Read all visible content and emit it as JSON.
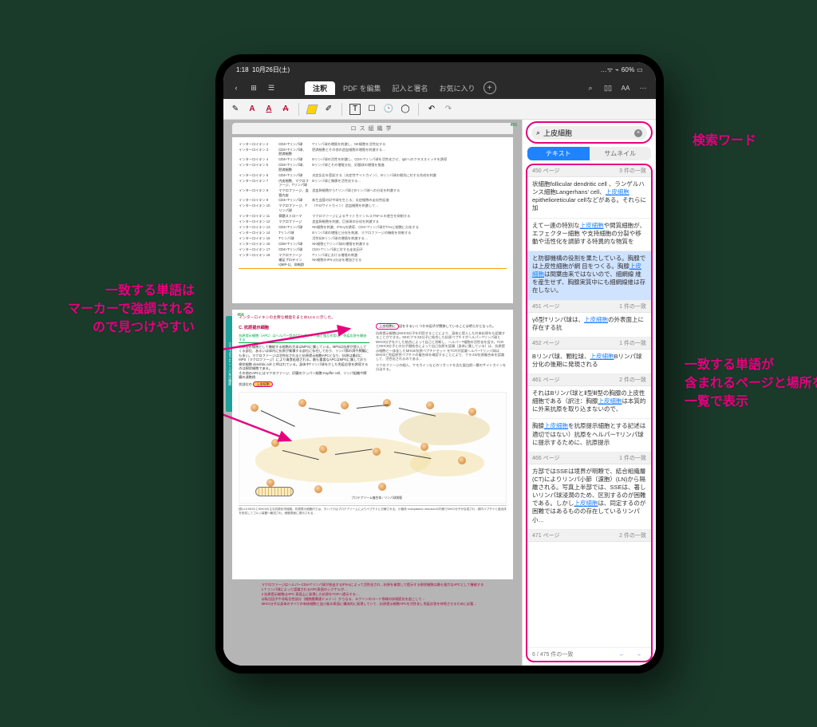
{
  "status": {
    "time": "1:18",
    "date": "10月26日(土)",
    "battery": "60%",
    "indicators": "…ᯤ ⌁"
  },
  "toolbar": {
    "tabs": {
      "active": "注釈",
      "edit": "PDF を編集",
      "sign": "記入と署名",
      "favorites": "お気に入り"
    }
  },
  "doc": {
    "tab_title": "ロス組織学",
    "page_a": "454",
    "page_b": "455",
    "section_title_c": "C. 抗原提示細胞",
    "section_sub_c": "抗原提示細胞（APC）はヘルパー型のCD4+Tリンパ球と相互作用し、免疫応答を開始する",
    "sidebar_label": "CHAPTER 14  リンパ系の機能",
    "highlight_term": "上皮細胞",
    "interleukins": [
      {
        "c1": "インターロイキン 2",
        "c2": "CD4+Tリンパ球",
        "c3": "Tリンパ球の増殖を刺激し、NK細胞を活性化する"
      },
      {
        "c1": "インターロイキン 3",
        "c2": "CD4+Tリンパ球、肥満細胞",
        "c3": "肥満細胞とその他の造血細胞の増殖を刺激する…"
      },
      {
        "c1": "インターロイキン 4",
        "c2": "CD4+Tリンパ球",
        "c3": "Bリンパ球の活性を刺激し、CD4+Tリンパ球を活性化させ、IgEへのクラススイッチを誘導"
      },
      {
        "c1": "インターロイキン 5",
        "c2": "CD4+Tリンパ球、肥満細胞",
        "c3": "Bリンパ球とその増殖分化、好酸球の増殖を推進"
      },
      {
        "c1": "インターロイキン 6",
        "c2": "CD4+Tリンパ球",
        "c3": "炎症反応を惹起する（炎症性サイトカイン）、Bリンパ球の場合に対する合成を刺激"
      },
      {
        "c1": "インターロイキン 7",
        "c2": "内皮細胞、マクロファージ、Tリンパ球",
        "c3": "Bリンパ球と胸腺を活性化する…"
      },
      {
        "c1": "インターロイキン 8",
        "c2": "マクロファージ、血管内皮",
        "c3": "造血幹細胞からTリンパ球とBリンパ球への分化を刺激する"
      },
      {
        "c1": "インターロイキン 9",
        "c2": "CD4+Tリンパ球",
        "c3": "新生血管の好中球を生じる；炎症細胞の走化性促進"
      },
      {
        "c1": "インターロイキン 10",
        "c2": "マクロファージ、Tリンパ球",
        "c3": "（TH2サイトカイン）造血細胞を刺激して…"
      },
      {
        "c1": "インターロイキン 11",
        "c2": "骨髄ストローマ",
        "c3": "マクロファージによるサイトカイン IL-2,TNF-α の産生を抑制する"
      },
      {
        "c1": "インターロイキン 12",
        "c2": "マクロファージ",
        "c3": "造血幹細胞を刺激、巨核球の分化を刺激する"
      },
      {
        "c1": "インターロイキン 13",
        "c2": "CD4+Tリンパ球",
        "c3": "NK細胞を刺激、IFN-γの誘導、CD4+Tリンパ球がTH1に細胞に分化する"
      },
      {
        "c1": "インターロイキン 14",
        "c2": "Tリンパ球",
        "c3": "Bリンパ球の増殖と分化を刺激、マクロファージの機能を抑制する"
      },
      {
        "c1": "インターロイキン 15",
        "c2": "Tリンパ球",
        "c3": "活性化Bリンパ球の増殖を刺激する…"
      },
      {
        "c1": "インターロイキン 16",
        "c2": "CD8+Tリンパ球",
        "c3": "NK細胞とTリンパ球の増殖を刺激する"
      },
      {
        "c1": "インターロイキン 17",
        "c2": "CD4+Tリンパ球",
        "c3": "CD4+Tリンパ球に対する走化因子"
      },
      {
        "c1": "インターロイキン 18",
        "c2": "マクロファージ",
        "c3": "Tリンパ球における増殖の刺激"
      },
      {
        "c1": "",
        "c2": "補足プロテインⅠ(MIP-1)、抑制群",
        "c3": "NK細胞のIFN-γ分泌を増加させる"
      }
    ]
  },
  "search": {
    "term": "上皮細胞",
    "tab_text": "テキスト",
    "tab_thumb": "サムネイル",
    "results": [
      {
        "page": "450 ページ",
        "count": "3 件の一致",
        "body": "状細胞follicular dendritic cell 、ランゲルハンス細胞Langerhans' cell、{kw}epithelioreticular cellなどがある。それらに加"
      },
      {
        "page": "",
        "count": "",
        "body": "えて一連の特別な{kw}や間質細胞が、エフェクター細胞 や支持細胞の分裂や移動や活性化を調節する特異的な物質を"
      },
      {
        "page": "",
        "count": "",
        "body": "と防御機構の役割を果たしている。胸腺では上皮性細胞が網 目をつくる。胸腺{kw}は間葉由来ではないので、細網線 維を産生せず、胸腺実質中にも細網線維は存在しない。",
        "active": true
      },
      {
        "page": "451 ページ",
        "count": "1 件の一致",
        "body": "γδ型Tリンパ球は、{kw}の外表面上に存在する抗"
      },
      {
        "page": "452 ページ",
        "count": "1 件の一致",
        "body": "Bリンパ球、顆粒球、{kw}Bリンパ球分化の後期に発現される"
      },
      {
        "page": "461 ページ",
        "count": "2 件の一致",
        "body": "それはBリンパ球とⅡ型Ⅲ型の胸腺の上皮性細胞である（訳注：胸腺{kw}は本質的に外来抗原を取り込まないので、"
      },
      {
        "page": "",
        "count": "",
        "body": "胸腺{kw}を抗原提示細胞とする記述は適切ではない）抗原をヘルパーTリンパ球に提示するために、抗原提示"
      },
      {
        "page": "466 ページ",
        "count": "1 件の一致",
        "body": "方部ではSSEは境界が明瞭で、結合組織層(CT)によりリンパ小節（濾胞）(LN)から隔離される。写真上半部では、SSEは、著しいリンパ球浸潤のため、区別するのが困難である。しかし{kw}は、同定するのが困難ではあるものの存在しているリンパ小…"
      },
      {
        "page": "471 ページ",
        "count": "2 件の一致",
        "body": ""
      }
    ],
    "footer": {
      "count": "6 / 475 件の一致"
    }
  },
  "callouts": {
    "left": "一致する単語は\nマーカーで強調される\nので見つけやすい",
    "top_right": "検索ワード",
    "right": "一致する単語が\n含まれるページと場所を\n一覧で表示"
  }
}
